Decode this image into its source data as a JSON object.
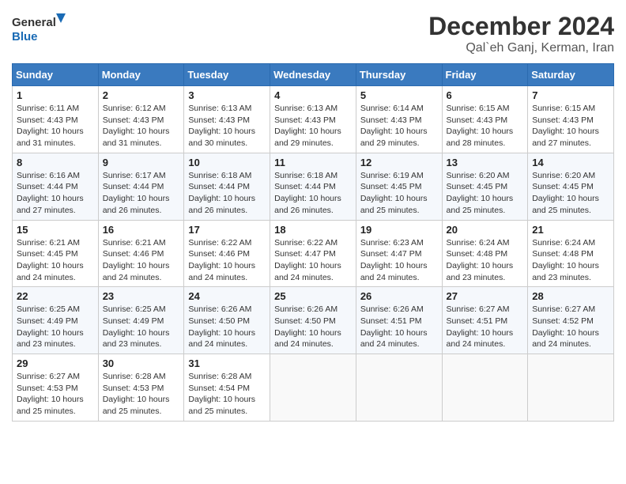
{
  "logo": {
    "line1": "General",
    "line2": "Blue"
  },
  "title": "December 2024",
  "location": "Qal`eh Ganj, Kerman, Iran",
  "days_of_week": [
    "Sunday",
    "Monday",
    "Tuesday",
    "Wednesday",
    "Thursday",
    "Friday",
    "Saturday"
  ],
  "weeks": [
    [
      {
        "day": 1,
        "sunrise": "6:11 AM",
        "sunset": "4:43 PM",
        "daylight": "10 hours and 31 minutes."
      },
      {
        "day": 2,
        "sunrise": "6:12 AM",
        "sunset": "4:43 PM",
        "daylight": "10 hours and 31 minutes."
      },
      {
        "day": 3,
        "sunrise": "6:13 AM",
        "sunset": "4:43 PM",
        "daylight": "10 hours and 30 minutes."
      },
      {
        "day": 4,
        "sunrise": "6:13 AM",
        "sunset": "4:43 PM",
        "daylight": "10 hours and 29 minutes."
      },
      {
        "day": 5,
        "sunrise": "6:14 AM",
        "sunset": "4:43 PM",
        "daylight": "10 hours and 29 minutes."
      },
      {
        "day": 6,
        "sunrise": "6:15 AM",
        "sunset": "4:43 PM",
        "daylight": "10 hours and 28 minutes."
      },
      {
        "day": 7,
        "sunrise": "6:15 AM",
        "sunset": "4:43 PM",
        "daylight": "10 hours and 27 minutes."
      }
    ],
    [
      {
        "day": 8,
        "sunrise": "6:16 AM",
        "sunset": "4:44 PM",
        "daylight": "10 hours and 27 minutes."
      },
      {
        "day": 9,
        "sunrise": "6:17 AM",
        "sunset": "4:44 PM",
        "daylight": "10 hours and 26 minutes."
      },
      {
        "day": 10,
        "sunrise": "6:18 AM",
        "sunset": "4:44 PM",
        "daylight": "10 hours and 26 minutes."
      },
      {
        "day": 11,
        "sunrise": "6:18 AM",
        "sunset": "4:44 PM",
        "daylight": "10 hours and 26 minutes."
      },
      {
        "day": 12,
        "sunrise": "6:19 AM",
        "sunset": "4:45 PM",
        "daylight": "10 hours and 25 minutes."
      },
      {
        "day": 13,
        "sunrise": "6:20 AM",
        "sunset": "4:45 PM",
        "daylight": "10 hours and 25 minutes."
      },
      {
        "day": 14,
        "sunrise": "6:20 AM",
        "sunset": "4:45 PM",
        "daylight": "10 hours and 25 minutes."
      }
    ],
    [
      {
        "day": 15,
        "sunrise": "6:21 AM",
        "sunset": "4:45 PM",
        "daylight": "10 hours and 24 minutes."
      },
      {
        "day": 16,
        "sunrise": "6:21 AM",
        "sunset": "4:46 PM",
        "daylight": "10 hours and 24 minutes."
      },
      {
        "day": 17,
        "sunrise": "6:22 AM",
        "sunset": "4:46 PM",
        "daylight": "10 hours and 24 minutes."
      },
      {
        "day": 18,
        "sunrise": "6:22 AM",
        "sunset": "4:47 PM",
        "daylight": "10 hours and 24 minutes."
      },
      {
        "day": 19,
        "sunrise": "6:23 AM",
        "sunset": "4:47 PM",
        "daylight": "10 hours and 24 minutes."
      },
      {
        "day": 20,
        "sunrise": "6:24 AM",
        "sunset": "4:48 PM",
        "daylight": "10 hours and 23 minutes."
      },
      {
        "day": 21,
        "sunrise": "6:24 AM",
        "sunset": "4:48 PM",
        "daylight": "10 hours and 23 minutes."
      }
    ],
    [
      {
        "day": 22,
        "sunrise": "6:25 AM",
        "sunset": "4:49 PM",
        "daylight": "10 hours and 23 minutes."
      },
      {
        "day": 23,
        "sunrise": "6:25 AM",
        "sunset": "4:49 PM",
        "daylight": "10 hours and 23 minutes."
      },
      {
        "day": 24,
        "sunrise": "6:26 AM",
        "sunset": "4:50 PM",
        "daylight": "10 hours and 24 minutes."
      },
      {
        "day": 25,
        "sunrise": "6:26 AM",
        "sunset": "4:50 PM",
        "daylight": "10 hours and 24 minutes."
      },
      {
        "day": 26,
        "sunrise": "6:26 AM",
        "sunset": "4:51 PM",
        "daylight": "10 hours and 24 minutes."
      },
      {
        "day": 27,
        "sunrise": "6:27 AM",
        "sunset": "4:51 PM",
        "daylight": "10 hours and 24 minutes."
      },
      {
        "day": 28,
        "sunrise": "6:27 AM",
        "sunset": "4:52 PM",
        "daylight": "10 hours and 24 minutes."
      }
    ],
    [
      {
        "day": 29,
        "sunrise": "6:27 AM",
        "sunset": "4:53 PM",
        "daylight": "10 hours and 25 minutes."
      },
      {
        "day": 30,
        "sunrise": "6:28 AM",
        "sunset": "4:53 PM",
        "daylight": "10 hours and 25 minutes."
      },
      {
        "day": 31,
        "sunrise": "6:28 AM",
        "sunset": "4:54 PM",
        "daylight": "10 hours and 25 minutes."
      },
      null,
      null,
      null,
      null
    ]
  ]
}
